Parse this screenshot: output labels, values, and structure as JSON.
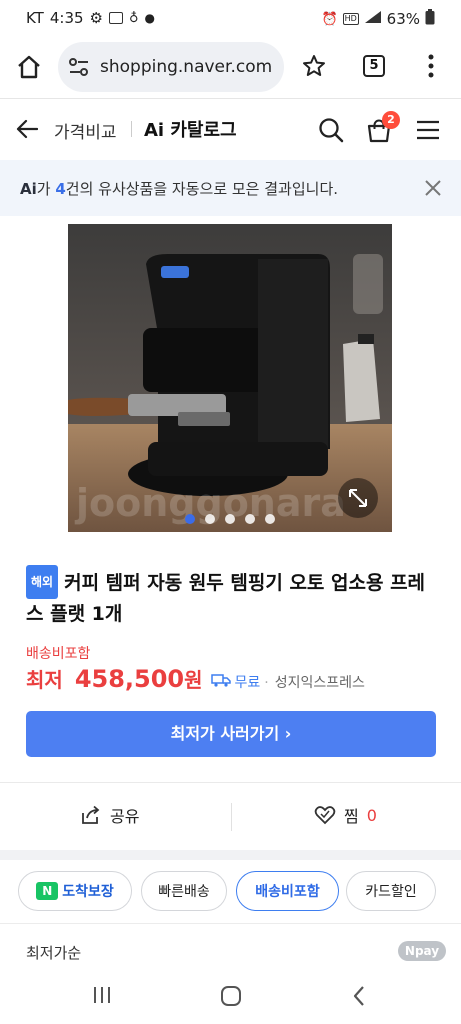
{
  "status_bar": {
    "carrier": "KT",
    "time": "4:35",
    "battery": "63%"
  },
  "browser": {
    "url": "shopping.naver.com",
    "tab_count": "5"
  },
  "header": {
    "crumb_compare": "가격비교",
    "crumb_catalog": "Ai 카탈로그",
    "cart_count": "2"
  },
  "banner": {
    "ai_prefix": "Ai",
    "text_before": "가 ",
    "count": "4",
    "text_after": "건의 유사상품을 자동으로 모은 결과입니다."
  },
  "product": {
    "image_dots": 5,
    "badge": "해외",
    "title": "커피 템퍼 자동 원두 템핑기 오토 업소용 프레스 플랫 1개",
    "shipping_included": "배송비포함",
    "price_label": "최저",
    "price": "458,500",
    "price_unit": "원",
    "free_shipping": "무료",
    "seller": "성지익스프레스"
  },
  "buy_button": "최저가 사러가기 ›",
  "share_label": "공유",
  "favorite_label": "찜",
  "favorite_count": "0",
  "filters": {
    "arrival": "도착보장",
    "fast_delivery": "빠른배송",
    "shipping_included": "배송비포함",
    "card_discount": "카드할인"
  },
  "sort_label": "최저가순",
  "npay_label": "pay",
  "colors": {
    "accent": "#4d7ff2",
    "price_red": "#ea3f3f",
    "banner_bg": "#f1f5fb",
    "arrival_green": "#18c464"
  }
}
